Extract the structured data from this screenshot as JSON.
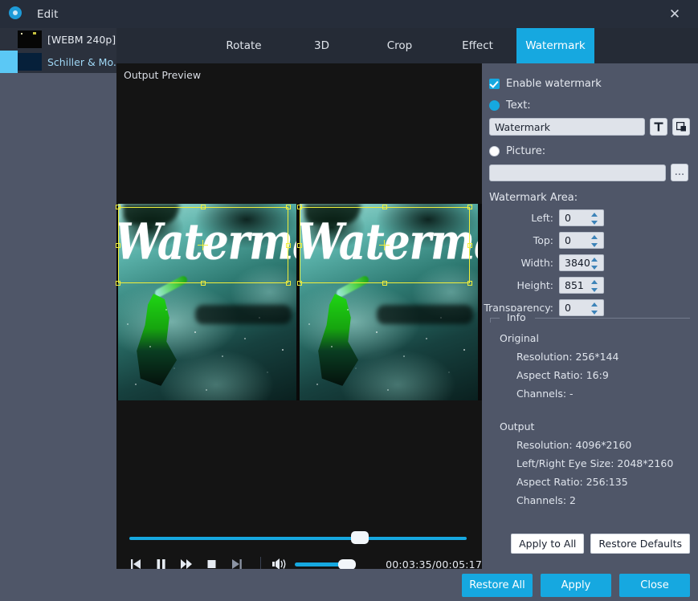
{
  "window": {
    "title": "Edit",
    "logo_icon": "app-logo-icon",
    "close_icon": "close-icon",
    "accent_color": "#16a8e0",
    "panel_color": "#4f5668",
    "titlebar_color": "#262d3a"
  },
  "filelist": {
    "items": [
      {
        "label": "[WEBM 240p] ..",
        "selected": false
      },
      {
        "label": "Schiller & Mo...",
        "selected": true
      }
    ]
  },
  "tabs": [
    {
      "label": "Rotate",
      "active": false
    },
    {
      "label": "3D",
      "active": false
    },
    {
      "label": "Crop",
      "active": false
    },
    {
      "label": "Effect",
      "active": false
    },
    {
      "label": "Watermark",
      "active": true
    }
  ],
  "preview": {
    "label": "Output Preview",
    "watermark_overlay_text": "Watermark",
    "selection_color": "#f2ef3a"
  },
  "player": {
    "prev_icon": "skip-previous-icon",
    "pause_icon": "pause-icon",
    "forward_icon": "fast-forward-icon",
    "stop_icon": "stop-icon",
    "next_icon": "skip-next-icon",
    "volume_icon": "volume-icon",
    "time": "00:03:35/00:05:17",
    "seek_percent": 66,
    "volume_percent": 70
  },
  "watermark": {
    "enable_label": "Enable watermark",
    "enable_checked": true,
    "text_radio_label": "Text:",
    "text_radio_selected": true,
    "text_value": "Watermark",
    "text_placeholder": "",
    "font_button_icon": "font-T-icon",
    "color_button_icon": "layers-color-icon",
    "picture_radio_label": "Picture:",
    "picture_radio_selected": false,
    "picture_value": "",
    "picture_placeholder": "",
    "browse_button_label": "...",
    "area_title": "Watermark Area:",
    "fields": [
      {
        "label": "Left:",
        "value": "0"
      },
      {
        "label": "Top:",
        "value": "0"
      },
      {
        "label": "Width:",
        "value": "3840"
      },
      {
        "label": "Height:",
        "value": "851"
      },
      {
        "label": "Transparency:",
        "value": "0"
      }
    ]
  },
  "info": {
    "legend": "Info",
    "original_title": "Original",
    "original_lines": [
      "Resolution: 256*144",
      "Aspect Ratio: 16:9",
      "Channels: -"
    ],
    "output_title": "Output",
    "output_lines": [
      "Resolution: 4096*2160",
      "Left/Right Eye Size: 2048*2160",
      "Aspect Ratio: 256:135",
      "Channels: 2"
    ]
  },
  "panel_buttons": {
    "apply_to_all": "Apply to All",
    "restore_defaults": "Restore Defaults"
  },
  "footer": {
    "restore_all": "Restore All",
    "apply": "Apply",
    "close": "Close"
  }
}
